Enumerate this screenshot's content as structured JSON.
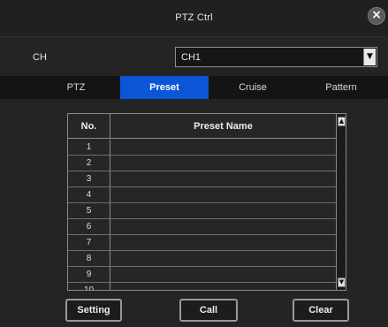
{
  "window": {
    "title": "PTZ Ctrl",
    "close_icon": "×"
  },
  "channel": {
    "label": "CH",
    "selected": "CH1",
    "arrow": "▼"
  },
  "tabs": [
    {
      "label": "PTZ",
      "active": false
    },
    {
      "label": "Preset",
      "active": true
    },
    {
      "label": "Cruise",
      "active": false
    },
    {
      "label": "Pattern",
      "active": false
    }
  ],
  "preset_table": {
    "headers": {
      "no": "No.",
      "name": "Preset Name"
    },
    "rows": [
      {
        "no": "1",
        "name": ""
      },
      {
        "no": "2",
        "name": ""
      },
      {
        "no": "3",
        "name": ""
      },
      {
        "no": "4",
        "name": ""
      },
      {
        "no": "5",
        "name": ""
      },
      {
        "no": "6",
        "name": ""
      },
      {
        "no": "7",
        "name": ""
      },
      {
        "no": "8",
        "name": ""
      },
      {
        "no": "9",
        "name": ""
      },
      {
        "no": "10",
        "name": ""
      }
    ],
    "scroll_up_icon": "▲",
    "scroll_down_icon": "▼"
  },
  "buttons": {
    "setting": "Setting",
    "call": "Call",
    "clear": "Clear"
  },
  "colors": {
    "accent": "#0b56d6",
    "background": "#242424",
    "text": "#e6e6e6"
  }
}
